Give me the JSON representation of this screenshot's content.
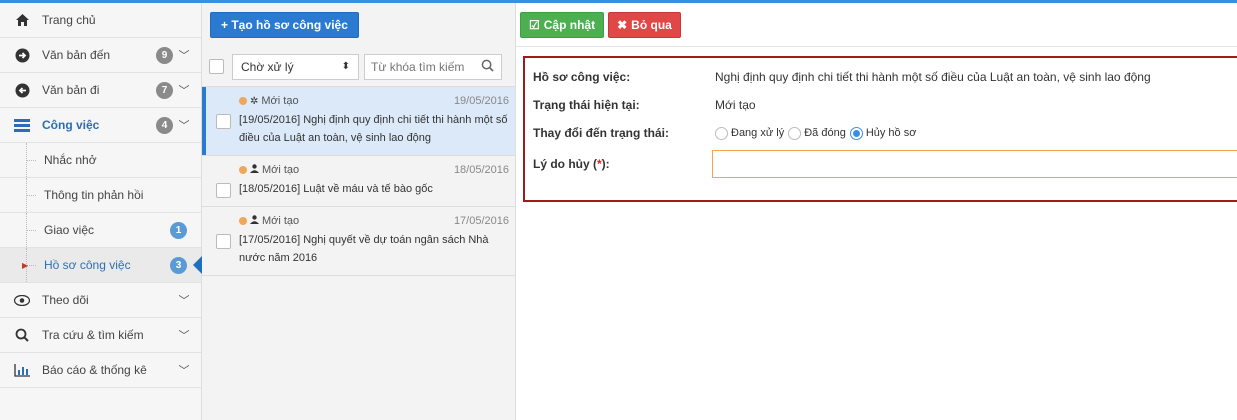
{
  "sidebar": {
    "items": [
      {
        "label": "Trang chủ",
        "icon": "home-icon"
      },
      {
        "label": "Văn bản đến",
        "icon": "arrow-right-circle-icon",
        "badge": "9"
      },
      {
        "label": "Văn bản đi",
        "icon": "arrow-left-circle-icon",
        "badge": "7"
      },
      {
        "label": "Công việc",
        "icon": "tasks-icon",
        "badge": "4"
      }
    ],
    "subitems": [
      {
        "label": "Nhắc nhở"
      },
      {
        "label": "Thông tin phản hồi"
      },
      {
        "label": "Giao việc",
        "badge": "1"
      },
      {
        "label": "Hồ sơ công việc",
        "badge": "3"
      }
    ],
    "bottom_items": [
      {
        "label": "Theo dõi",
        "icon": "eye-icon"
      },
      {
        "label": "Tra cứu & tìm kiếm",
        "icon": "search-icon"
      },
      {
        "label": "Báo cáo & thống kê",
        "icon": "bar-chart-icon"
      }
    ]
  },
  "list": {
    "create_button": "+ Tạo hồ sơ công việc",
    "filter_value": "Chờ xử lý",
    "search_placeholder": "Từ khóa tìm kiếm",
    "items": [
      {
        "status": "Mới tạo",
        "date": "19/05/2016",
        "title": "[19/05/2016] Nghị định quy định chi tiết thi hành một số điều của Luật an toàn, vệ sinh lao động"
      },
      {
        "status": "Mới tạo",
        "date": "18/05/2016",
        "title": "[18/05/2016] Luật về máu và tế bào gốc"
      },
      {
        "status": "Mới tạo",
        "date": "17/05/2016",
        "title": "[17/05/2016] Nghị quyết về dự toán ngân sách Nhà nước năm 2016"
      }
    ]
  },
  "detail": {
    "update_button": "Cập nhật",
    "cancel_button": "Bỏ qua",
    "fields": {
      "profile_label": "Hồ sơ công việc:",
      "profile_value": "Nghị định quy định chi tiết thi hành một số điều của Luật an toàn, vệ sinh lao động",
      "current_status_label": "Trạng thái hiện tại:",
      "current_status_value": "Mới tạo",
      "change_status_label": "Thay đổi đến trạng thái:",
      "options": [
        "Đang xử lý",
        "Đã đóng",
        "Hủy hồ sơ"
      ],
      "selected_option": "Hủy hồ sơ",
      "reason_label": "Lý do hủy (",
      "reason_required": "*",
      "reason_label_end": "):"
    }
  },
  "colors": {
    "accent": "#2a7ad1",
    "green": "#4caf50",
    "red": "#e04848",
    "form_border": "#9b1c1c"
  }
}
